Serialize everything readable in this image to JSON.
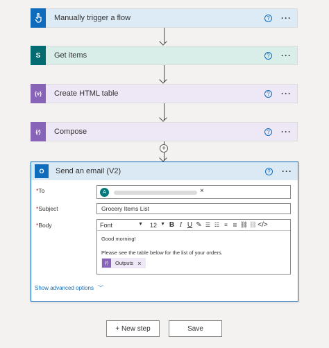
{
  "steps": [
    {
      "title": "Manually trigger a flow",
      "icon": "touch-icon",
      "color": "#0f6cbd",
      "bg": "#ddebf7"
    },
    {
      "title": "Get items",
      "icon": "sharepoint-icon",
      "color": "#036c70",
      "bg": "#d9ede9"
    },
    {
      "title": "Create HTML table",
      "icon": "data-operation-icon",
      "color": "#8764b8",
      "bg": "#ede7f6"
    },
    {
      "title": "Compose",
      "icon": "data-operation-icon",
      "color": "#8764b8",
      "bg": "#ede7f6"
    }
  ],
  "help_glyph": "?",
  "more_glyph": "···",
  "email": {
    "title": "Send an email (V2)",
    "to_label": "To",
    "to_avatar": "A",
    "subject_label": "Subject",
    "subject_value": "Grocery Items List",
    "body_label": "Body",
    "toolbar": {
      "font": "Font",
      "size": "12"
    },
    "body_line1": "Good morning!",
    "body_line2": "Please see the table below for the list of your orders.",
    "token_label": "Outputs",
    "show_advanced": "Show advanced options"
  },
  "buttons": {
    "new_step": "+ New step",
    "save": "Save"
  }
}
